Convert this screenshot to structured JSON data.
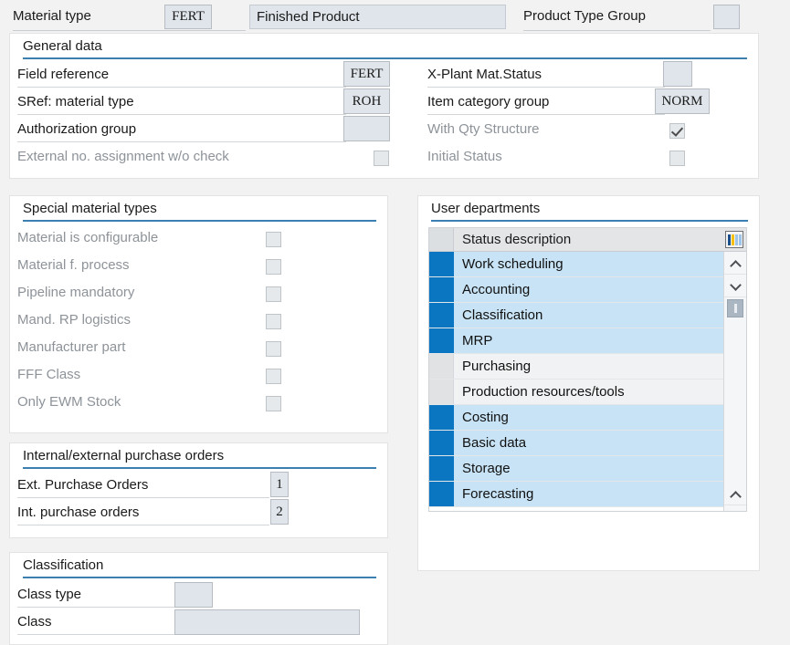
{
  "header": {
    "material_type_label": "Material type",
    "material_type_value": "FERT",
    "description_value": "Finished Product",
    "product_type_group_label": "Product Type Group",
    "product_type_group_value": ""
  },
  "general_data": {
    "title": "General data",
    "left_rows": [
      {
        "label": "Field reference",
        "value": "FERT",
        "dim": false
      },
      {
        "label": "SRef: material type",
        "value": "ROH",
        "dim": false
      },
      {
        "label": "Authorization group",
        "value": "",
        "dim": false
      }
    ],
    "left_checkbox": {
      "label": "External no. assignment w/o check",
      "checked": false,
      "dim": true
    },
    "right_rows": [
      {
        "label": "X-Plant Mat.Status",
        "value": "",
        "dim": false
      },
      {
        "label": "Item category group",
        "value": "NORM",
        "dim": false
      }
    ],
    "right_checkboxes": [
      {
        "label": "With Qty Structure",
        "checked": true,
        "dim": true
      },
      {
        "label": "Initial Status",
        "checked": false,
        "dim": true
      }
    ]
  },
  "special_material_types": {
    "title": "Special material types",
    "items": [
      {
        "label": "Material is configurable",
        "checked": false
      },
      {
        "label": "Material f. process",
        "checked": false
      },
      {
        "label": "Pipeline mandatory",
        "checked": false
      },
      {
        "label": "Mand. RP logistics",
        "checked": false
      },
      {
        "label": "Manufacturer part",
        "checked": false
      },
      {
        "label": "FFF Class",
        "checked": false
      },
      {
        "label": "Only EWM Stock",
        "checked": false
      }
    ]
  },
  "purchase_orders": {
    "title": "Internal/external purchase orders",
    "rows": [
      {
        "label": "Ext. Purchase Orders",
        "value": "1"
      },
      {
        "label": "Int. purchase orders",
        "value": "2"
      }
    ]
  },
  "classification": {
    "title": "Classification",
    "rows": [
      {
        "label": "Class type",
        "value": ""
      },
      {
        "label": "Class",
        "value": ""
      }
    ]
  },
  "user_departments": {
    "title": "User departments",
    "column_header": "Status description",
    "settings_icon": "table-columns-icon",
    "rows": [
      {
        "label": "Work scheduling",
        "selected": true
      },
      {
        "label": "Accounting",
        "selected": true
      },
      {
        "label": "Classification",
        "selected": true
      },
      {
        "label": "MRP",
        "selected": true
      },
      {
        "label": "Purchasing",
        "selected": false
      },
      {
        "label": "Production resources/tools",
        "selected": false
      },
      {
        "label": "Costing",
        "selected": true
      },
      {
        "label": "Basic data",
        "selected": true
      },
      {
        "label": "Storage",
        "selected": true
      },
      {
        "label": "Forecasting",
        "selected": true
      }
    ],
    "scroll_up_icon": "chevron-up-icon",
    "scroll_down_icon": "chevron-down-icon"
  },
  "colors": {
    "accent_rule": "#3c7fb1",
    "selected_row": "#c7e3f5",
    "selector_cell": "#0a76c2",
    "field_bg": "#dfe5ea"
  }
}
